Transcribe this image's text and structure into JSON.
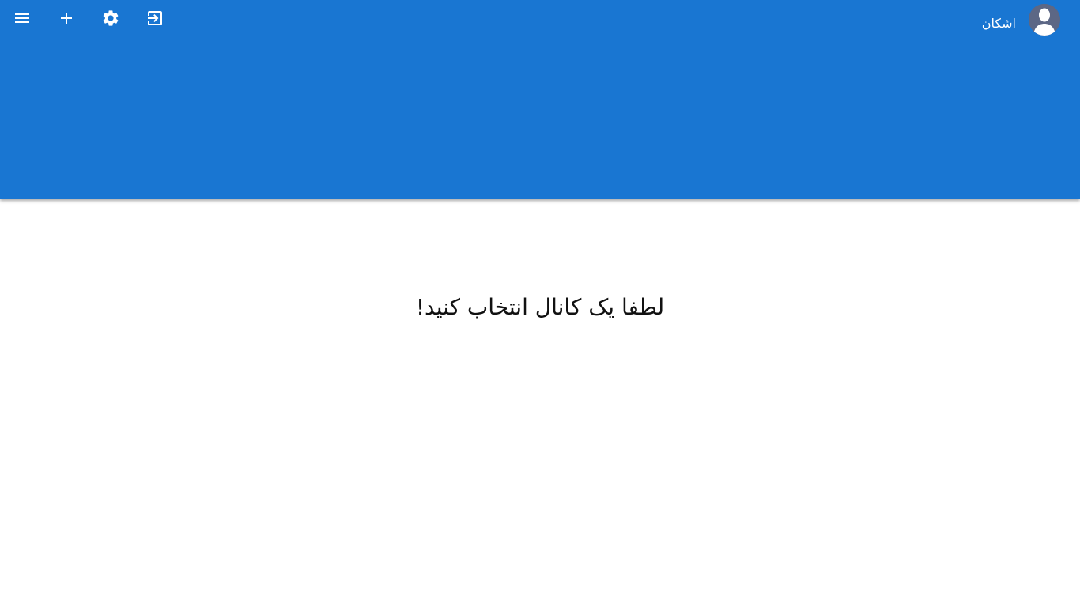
{
  "colors": {
    "header_bg": "#1976d2",
    "icon_color": "#ffffff",
    "avatar_bg": "#5c6785",
    "text": "#111111"
  },
  "toolbar": {
    "icons": [
      "menu-icon",
      "add-icon",
      "settings-icon",
      "logout-icon"
    ]
  },
  "user": {
    "name": "اشکان"
  },
  "main": {
    "message": "لطفا یک کانال انتخاب کنید!"
  }
}
